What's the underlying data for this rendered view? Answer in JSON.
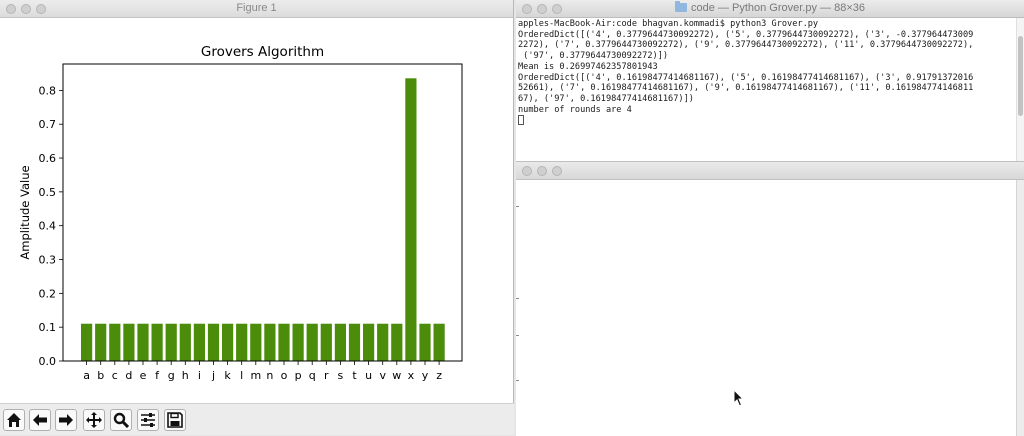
{
  "figure_window": {
    "title": "Figure 1",
    "toolbar": [
      "home-icon",
      "back-arrow-icon",
      "forward-arrow-icon",
      "pan-icon",
      "zoom-icon",
      "configure-subplots-icon",
      "save-icon"
    ]
  },
  "chart_data": {
    "type": "bar",
    "title": "Grovers Algorithm",
    "xlabel": "",
    "ylabel": "Amplitude Value",
    "categories": [
      "a",
      "b",
      "c",
      "d",
      "e",
      "f",
      "g",
      "h",
      "i",
      "j",
      "k",
      "l",
      "m",
      "n",
      "o",
      "p",
      "q",
      "r",
      "s",
      "t",
      "u",
      "v",
      "w",
      "x",
      "y",
      "z"
    ],
    "values": [
      0.1102,
      0.1102,
      0.1102,
      0.1102,
      0.1102,
      0.1102,
      0.1102,
      0.1102,
      0.1102,
      0.1102,
      0.1102,
      0.1102,
      0.1102,
      0.1102,
      0.1102,
      0.1102,
      0.1102,
      0.1102,
      0.1102,
      0.1102,
      0.1102,
      0.1102,
      0.1102,
      0.8357,
      0.1102,
      0.1102
    ],
    "ylim": [
      0,
      0.878
    ],
    "yticks": [
      0.0,
      0.1,
      0.2,
      0.3,
      0.4,
      0.5,
      0.6,
      0.7,
      0.8
    ],
    "ytick_labels": [
      "0.0",
      "0.1",
      "0.2",
      "0.3",
      "0.4",
      "0.5",
      "0.6",
      "0.7",
      "0.8"
    ],
    "bar_color": "#4b8c0a",
    "grid": false
  },
  "terminal": {
    "title": "code — Python Grover.py — 88×36",
    "lines": [
      "apples-MacBook-Air:code bhagvan.kommadi$ python3 Grover.py",
      "OrderedDict([('4', 0.3779644730092272), ('5', 0.3779644730092272), ('3', -0.377964473009",
      "2272), ('7', 0.3779644730092272), ('9', 0.3779644730092272), ('11', 0.3779644730092272),",
      " ('97', 0.3779644730092272)])",
      "Mean is 0.26997462357801943",
      "OrderedDict([('4', 0.16198477414681167), ('5', 0.16198477414681167), ('3', 0.91791372016",
      "52661), ('7', 0.16198477414681167), ('9', 0.16198477414681167), ('11', 0.161984774146811",
      "67), ('97', 0.16198477414681167)])",
      "number of rounds are 4"
    ]
  },
  "background_window": {
    "title": ""
  }
}
